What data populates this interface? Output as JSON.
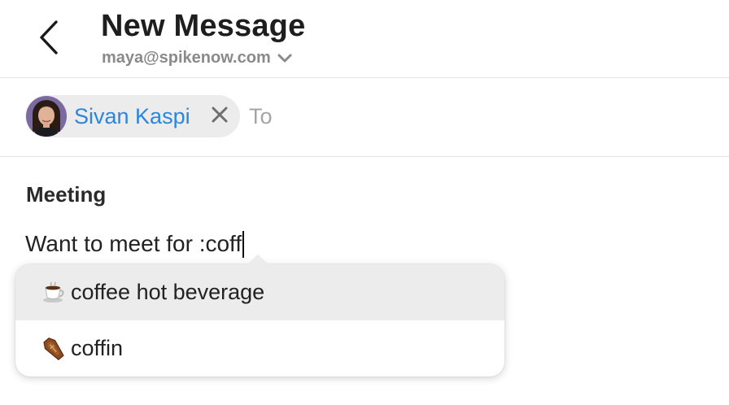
{
  "header": {
    "title": "New Message",
    "account_email": "maya@spikenow.com",
    "back_icon": "chevron-left-icon",
    "account_dropdown_icon": "chevron-down-icon"
  },
  "recipients": {
    "chips": [
      {
        "name": "Sivan Kaspi",
        "avatar": "avatar",
        "remove_icon": "close-icon"
      }
    ],
    "to_placeholder": "To"
  },
  "message": {
    "subject": "Meeting",
    "body": "Want to meet for :coff"
  },
  "emoji_suggestions": [
    {
      "emoji": "coffee-cup-icon",
      "label": "coffee hot beverage",
      "highlighted": true
    },
    {
      "emoji": "coffin-icon",
      "label": "coffin",
      "highlighted": false
    }
  ],
  "colors": {
    "accent": "#2b86e0",
    "chip_background": "#ececec",
    "divider": "#e3e3e3",
    "muted_text": "#8a8a8a"
  }
}
